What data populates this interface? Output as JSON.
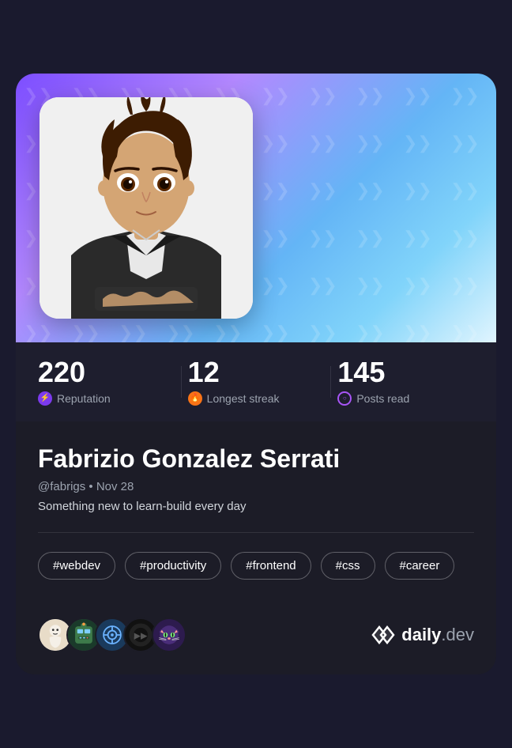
{
  "card": {
    "header": {
      "alt": "Profile header background"
    },
    "avatar": {
      "alt": "Fabrizio Gonzalez Serrati profile avatar - manga style"
    },
    "stats": [
      {
        "id": "reputation",
        "value": "220",
        "label": "Reputation",
        "icon_type": "lightning",
        "icon_color": "#7c3aed"
      },
      {
        "id": "streak",
        "value": "12",
        "label": "Longest streak",
        "icon_type": "flame",
        "icon_color": "#f97316"
      },
      {
        "id": "posts",
        "value": "145",
        "label": "Posts read",
        "icon_type": "circle",
        "icon_color": "#a855f7"
      }
    ],
    "profile": {
      "name": "Fabrizio Gonzalez Serrati",
      "username": "@fabrigs",
      "join_date": "Nov 28",
      "bio": "Something new to learn-build every day",
      "tags": [
        "#webdev",
        "#productivity",
        "#frontend",
        "#css",
        "#career"
      ]
    },
    "footer": {
      "avatars": [
        {
          "id": 1,
          "emoji": "🪆",
          "bg": "#f5f0e8"
        },
        {
          "id": 2,
          "emoji": "🤖",
          "bg": "#2d5a3d"
        },
        {
          "id": 3,
          "emoji": "🎯",
          "bg": "#1a3a5c"
        },
        {
          "id": 4,
          "emoji": "⚫",
          "bg": "#111111"
        },
        {
          "id": 5,
          "emoji": "🐱",
          "bg": "#2d1b4e"
        }
      ],
      "brand": {
        "name": "daily",
        "suffix": ".dev"
      }
    }
  }
}
